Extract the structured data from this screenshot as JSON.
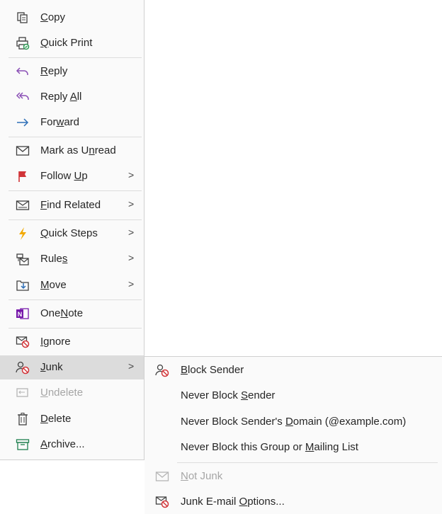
{
  "menu": {
    "items": [
      {
        "id": "copy",
        "label": "Copy",
        "ul": "C",
        "icon": "copy-icon"
      },
      {
        "id": "quick-print",
        "label": "Quick Print",
        "ul": "Q",
        "icon": "quick-print-icon"
      },
      {
        "id": "reply",
        "label": "Reply",
        "ul": "R",
        "icon": "reply-icon"
      },
      {
        "id": "reply-all",
        "label": "Reply All",
        "ul": "A",
        "icon": "reply-all-icon"
      },
      {
        "id": "forward",
        "label": "Forward",
        "ul": "w",
        "icon": "forward-icon"
      },
      {
        "id": "mark-unread",
        "label": "Mark as Unread",
        "ul": "n",
        "icon": "envelope-icon"
      },
      {
        "id": "follow-up",
        "label": "Follow Up",
        "ul": "U",
        "icon": "flag-icon",
        "submenu": true
      },
      {
        "id": "find-related",
        "label": "Find Related",
        "ul": "F",
        "icon": "find-related-icon",
        "submenu": true
      },
      {
        "id": "quick-steps",
        "label": "Quick Steps",
        "ul": "Q",
        "icon": "lightning-icon",
        "submenu": true
      },
      {
        "id": "rules",
        "label": "Rules",
        "ul": "s",
        "icon": "rules-icon",
        "submenu": true
      },
      {
        "id": "move",
        "label": "Move",
        "ul": "M",
        "icon": "move-icon",
        "submenu": true
      },
      {
        "id": "onenote",
        "label": "OneNote",
        "ul": "N",
        "icon": "onenote-icon"
      },
      {
        "id": "ignore",
        "label": "Ignore",
        "ul": "I",
        "icon": "ignore-icon"
      },
      {
        "id": "junk",
        "label": "Junk",
        "ul": "J",
        "icon": "junk-icon",
        "submenu": true,
        "highlighted": true
      },
      {
        "id": "undelete",
        "label": "Undelete",
        "ul": "U",
        "icon": "undelete-icon",
        "disabled": true
      },
      {
        "id": "delete",
        "label": "Delete",
        "ul": "D",
        "icon": "trash-icon"
      },
      {
        "id": "archive",
        "label": "Archive...",
        "ul": "A",
        "icon": "archive-icon"
      }
    ],
    "submenu_arrow": ">"
  },
  "junk_submenu": {
    "items": [
      {
        "id": "block-sender",
        "label": "Block Sender",
        "ul": "B",
        "icon": "block-sender-icon"
      },
      {
        "id": "never-block-sender",
        "label": "Never Block Sender",
        "ul": "S"
      },
      {
        "id": "never-block-domain",
        "label": "Never Block Sender's Domain (@example.com)",
        "ul": "D"
      },
      {
        "id": "never-block-group",
        "label": "Never Block this Group or Mailing List",
        "ul": "M"
      },
      {
        "id": "not-junk",
        "label": "Not Junk",
        "ul": "N",
        "icon": "not-junk-icon",
        "disabled": true
      },
      {
        "id": "junk-options",
        "label": "Junk E-mail Options...",
        "ul": "O",
        "icon": "junk-options-icon"
      }
    ]
  },
  "colors": {
    "accent_blue": "#2e6fb7",
    "reply_purple": "#8a4fb5",
    "flag_red": "#d13438",
    "lightning": "#f2a900",
    "onenote": "#7719aa",
    "archive_green": "#1e7f4f",
    "print_green": "#2d9c55"
  }
}
